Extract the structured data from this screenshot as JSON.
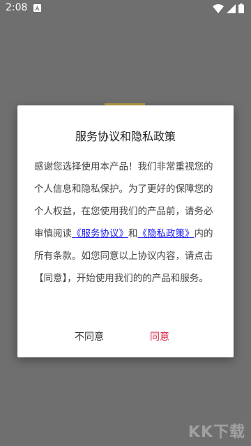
{
  "status_bar": {
    "time": "2:08"
  },
  "dialog": {
    "title": "服务协议和隐私政策",
    "body_part1": "感谢您选择使用本产品！我们非常重视您的个人信息和隐私保护。为了更好的保障您的个人权益，在您使用我们的产品前，请务必审慎阅读",
    "service_link": "《服务协议》",
    "and": "和",
    "privacy_link": "《隐私政策》",
    "body_part2": "内的所有条款。如您同意以上协议内容，请点击【同意】，开始使用我们的的产品和服务。",
    "disagree_label": "不同意",
    "agree_label": "同意"
  },
  "watermark": {
    "text": "KK下载"
  },
  "colors": {
    "overlay": "#6f6f6f",
    "agree": "#d81e3d",
    "link": "#1a1aee"
  }
}
